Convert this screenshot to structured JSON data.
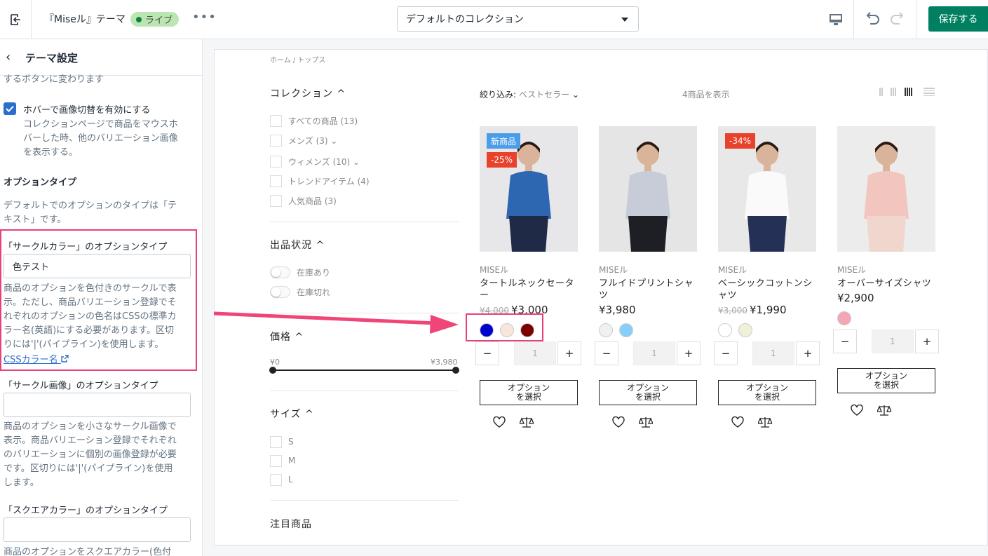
{
  "topbar": {
    "theme_title": "『Miseル』テーマ",
    "live_badge": "ライブ",
    "more": "•••",
    "collection_select": "デフォルトのコレクション",
    "save_label": "保存する"
  },
  "sidebar": {
    "header_title": "テーマ設定",
    "intro_text": "するボタンに変わります",
    "hover_checkbox": {
      "label": "ホバーで画像切替を有効にする",
      "checked": true
    },
    "hover_help": [
      "コレクションページで商品をマウスホ",
      "バーした時、他のバリエーション画像",
      "を表示する。"
    ],
    "option_type_heading": "オプションタイプ",
    "option_type_desc": [
      "デフォルトでのオプションのタイプは「テ",
      "キスト」です。"
    ],
    "circle_color": {
      "label": "「サークルカラー」のオプションタイプ",
      "value": "色テスト",
      "help": [
        "商品のオプションを色付きのサークルで表",
        "示。ただし、商品バリエーション登録でそ",
        "れぞれのオプションの色名はCSSの標準カ",
        "ラー名(英語)にする必要があります。区切",
        "りには'|'(パイプライン)を使用します。"
      ],
      "link": "CSSカラー名"
    },
    "circle_image": {
      "label": "「サークル画像」のオプションタイプ",
      "value": "",
      "help": [
        "商品のオプションを小さなサークル画像で",
        "表示。商品バリエーション登録でそれぞれ",
        "のバリエーションに個別の画像登録が必要",
        "です。区切りには'|'(パイプライン)を使用",
        "します。"
      ]
    },
    "square_color": {
      "label": "「スクエアカラー」のオプションタイプ",
      "value": "",
      "help": [
        "商品のオプションをスクエアカラー(色付"
      ]
    }
  },
  "store": {
    "breadcrumb": "ホーム / トップス",
    "filters": {
      "collection": {
        "title": "コレクション ^",
        "items": [
          "すべての商品 (13)",
          "メンズ (3) ⌄",
          "ウィメンズ (10) ⌄",
          "トレンドアイテム (4)",
          "人気商品 (3)"
        ]
      },
      "availability": {
        "title": "出品状況 ^",
        "items": [
          "在庫あり",
          "在庫切れ"
        ]
      },
      "price": {
        "title": "価格 ^",
        "min": "¥0",
        "max": "¥3,980"
      },
      "size": {
        "title": "サイズ ^",
        "items": [
          "S",
          "M",
          "L"
        ]
      },
      "featured": {
        "title": "注目商品"
      }
    },
    "sort_label": "絞り込み:",
    "sort_value": "ベストセラー",
    "product_count": "4商品を表示",
    "qty_default": "1",
    "option_button": "オプション\nを選択",
    "products": [
      {
        "vendor": "MISEル",
        "name": "タートルネックセータ\nー",
        "old_price": "¥4,000",
        "price": "¥3,000",
        "tags": [
          "新商品",
          "-25%"
        ],
        "swatches": [
          "#0000cd",
          "#f8e6dc",
          "#7b0000"
        ],
        "img_bg": "#e7e7e9",
        "figure": "#2d66b1",
        "pants": "#1e2a46"
      },
      {
        "vendor": "MISEル",
        "name": "フルイドプリントシャ\nツ",
        "old_price": "",
        "price": "¥3,980",
        "tags": [],
        "swatches": [
          "#f0f0f0",
          "#87cefa"
        ],
        "img_bg": "#e5e5e5",
        "figure": "#c7ccd8",
        "pants": "#1d1f25"
      },
      {
        "vendor": "MISEル",
        "name": "ベーシックコットンシ\nャツ",
        "old_price": "¥3,000",
        "price": "¥1,990",
        "tags": [
          "-34%"
        ],
        "swatches": [
          "#ffffff",
          "#f0f0d8"
        ],
        "img_bg": "#e8e8e8",
        "figure": "#fafafa",
        "pants": "#253056"
      },
      {
        "vendor": "MISEル",
        "name": "オーバーサイズシャツ",
        "old_price": "",
        "price": "¥2,900",
        "tags": [],
        "swatches": [
          "#f4a6b4"
        ],
        "img_bg": "#ececec",
        "figure": "#f2c6be",
        "pants": "#f0d6cc"
      }
    ]
  }
}
